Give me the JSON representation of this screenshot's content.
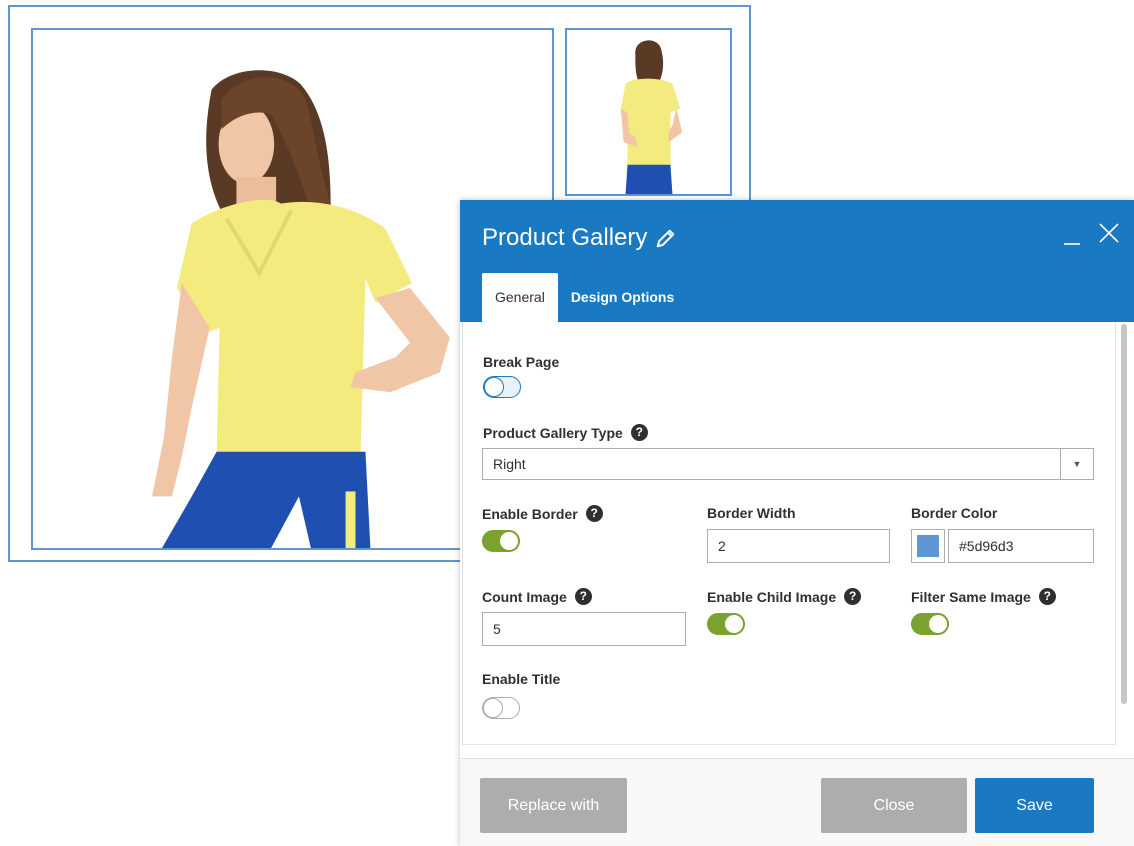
{
  "modal": {
    "title": "Product Gallery",
    "tabs": [
      {
        "label": "General",
        "active": true
      },
      {
        "label": "Design Options",
        "active": false
      }
    ],
    "fields": {
      "break_page": {
        "label": "Break Page",
        "enabled": false
      },
      "gallery_type": {
        "label": "Product Gallery Type",
        "value": "Right"
      },
      "enable_border": {
        "label": "Enable Border",
        "enabled": true
      },
      "border_width": {
        "label": "Border Width",
        "value": "2"
      },
      "border_color": {
        "label": "Border Color",
        "value": "#5d96d3"
      },
      "count_image": {
        "label": "Count Image",
        "value": "5"
      },
      "enable_child_image": {
        "label": "Enable Child Image",
        "enabled": true
      },
      "filter_same_image": {
        "label": "Filter Same Image",
        "enabled": true
      },
      "enable_title": {
        "label": "Enable Title",
        "enabled": false
      }
    },
    "help_glyph": "?",
    "footer": {
      "replace_label": "Replace with",
      "close_label": "Close",
      "save_label": "Save"
    }
  },
  "colors": {
    "header": "#1979c3",
    "toggle_on": "#79a22e",
    "gallery_border": "#5d96d3",
    "button_gray": "#adadad",
    "button_primary": "#1979c3"
  },
  "icons": [
    "pencil-icon",
    "minimize-icon",
    "close-icon",
    "help-icon",
    "chevron-down-icon"
  ]
}
